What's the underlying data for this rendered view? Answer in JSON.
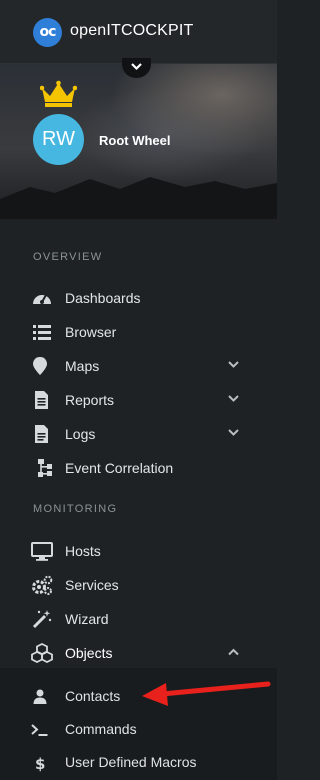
{
  "app": {
    "logo_text": "oc",
    "title": "openITCOCKPIT"
  },
  "user": {
    "initials": "RW",
    "name": "Root Wheel"
  },
  "sections": {
    "overview": "OVERVIEW",
    "monitoring": "MONITORING"
  },
  "overview_items": [
    {
      "label": "Dashboards",
      "icon": "dashboard-gauge-icon"
    },
    {
      "label": "Browser",
      "icon": "list-icon"
    },
    {
      "label": "Maps",
      "icon": "map-marker-icon",
      "expandable": true
    },
    {
      "label": "Reports",
      "icon": "file-text-icon",
      "expandable": true
    },
    {
      "label": "Logs",
      "icon": "file-icon",
      "expandable": true
    },
    {
      "label": "Event Correlation",
      "icon": "sitemap-icon"
    }
  ],
  "monitoring_items": [
    {
      "label": "Hosts",
      "icon": "desktop-icon"
    },
    {
      "label": "Services",
      "icon": "cogs-icon"
    },
    {
      "label": "Wizard",
      "icon": "magic-wand-icon"
    },
    {
      "label": "Objects",
      "icon": "cubes-icon",
      "expanded": true
    }
  ],
  "objects_subitems": [
    {
      "label": "Contacts",
      "icon": "user-icon"
    },
    {
      "label": "Commands",
      "icon": "terminal-icon"
    },
    {
      "label": "User Defined Macros",
      "icon": "dollar-icon"
    }
  ],
  "colors": {
    "sidebar_bg": "#1e2224",
    "avatar": "#45b7e0",
    "logo": "#2f7fd8",
    "crown": "#f5c400",
    "annotation_arrow": "#e8211c"
  }
}
